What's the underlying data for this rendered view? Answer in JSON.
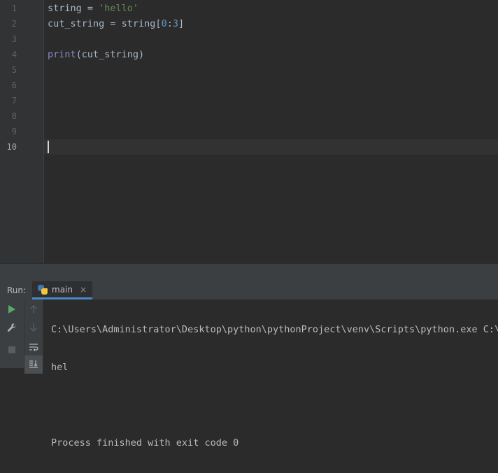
{
  "editor": {
    "line_numbers": [
      "1",
      "2",
      "3",
      "4",
      "5",
      "6",
      "7",
      "8",
      "9",
      "10"
    ],
    "lines": [
      {
        "parts": [
          {
            "t": "string = ",
            "c": ""
          },
          {
            "t": "'hello'",
            "c": "str"
          }
        ]
      },
      {
        "parts": [
          {
            "t": "cut_string = string[",
            "c": ""
          },
          {
            "t": "0",
            "c": "num"
          },
          {
            "t": ":",
            "c": ""
          },
          {
            "t": "3",
            "c": "num"
          },
          {
            "t": "]",
            "c": ""
          }
        ]
      },
      {
        "parts": []
      },
      {
        "parts": [
          {
            "t": "print",
            "c": "fn"
          },
          {
            "t": "(cut_string)",
            "c": ""
          }
        ]
      }
    ],
    "current_line": 10
  },
  "run_panel": {
    "label": "Run:",
    "tab_label": "main",
    "tab_close": "×",
    "console_lines": [
      "C:\\Users\\Administrator\\Desktop\\python\\pythonProject\\venv\\Scripts\\python.exe C:\\Users\\",
      "hel",
      "",
      "Process finished with exit code 0"
    ]
  },
  "icons": {
    "rerun": "play-icon",
    "settings": "wrench-icon",
    "stop": "stop-icon",
    "up": "arrow-up-icon",
    "down": "arrow-down-icon",
    "wrap": "soft-wrap-icon",
    "scroll_end": "scroll-to-end-icon"
  },
  "colors": {
    "background": "#2b2b2b",
    "string": "#6a8759",
    "number": "#6897bb",
    "builtin": "#8888c6",
    "text": "#a9b7c6",
    "run_green": "#59a869"
  }
}
